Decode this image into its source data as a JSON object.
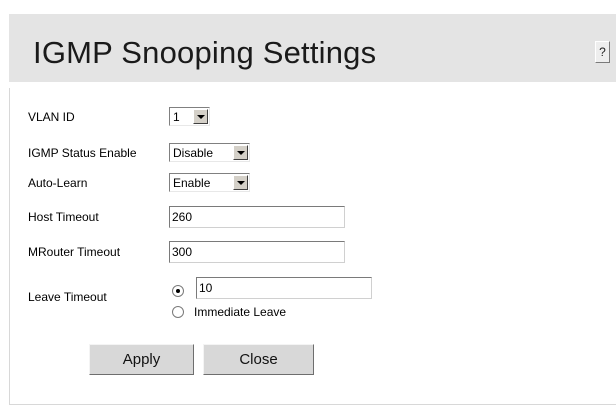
{
  "header": {
    "title": "IGMP Snooping Settings",
    "help_label": "?"
  },
  "form": {
    "vlan_id": {
      "label": "VLAN ID",
      "value": "1"
    },
    "igmp_status": {
      "label": "IGMP Status Enable",
      "value": "Disable"
    },
    "auto_learn": {
      "label": "Auto-Learn",
      "value": "Enable"
    },
    "host_timeout": {
      "label": "Host Timeout",
      "value": "260"
    },
    "mrouter_timeout": {
      "label": "MRouter Timeout",
      "value": "300"
    },
    "leave_timeout": {
      "label": "Leave Timeout",
      "value": "10",
      "immediate_label": "Immediate Leave",
      "selected": "custom"
    }
  },
  "buttons": {
    "apply": "Apply",
    "close": "Close"
  },
  "icons": {
    "dropdown": "chevron-down-icon",
    "help": "help-icon"
  }
}
